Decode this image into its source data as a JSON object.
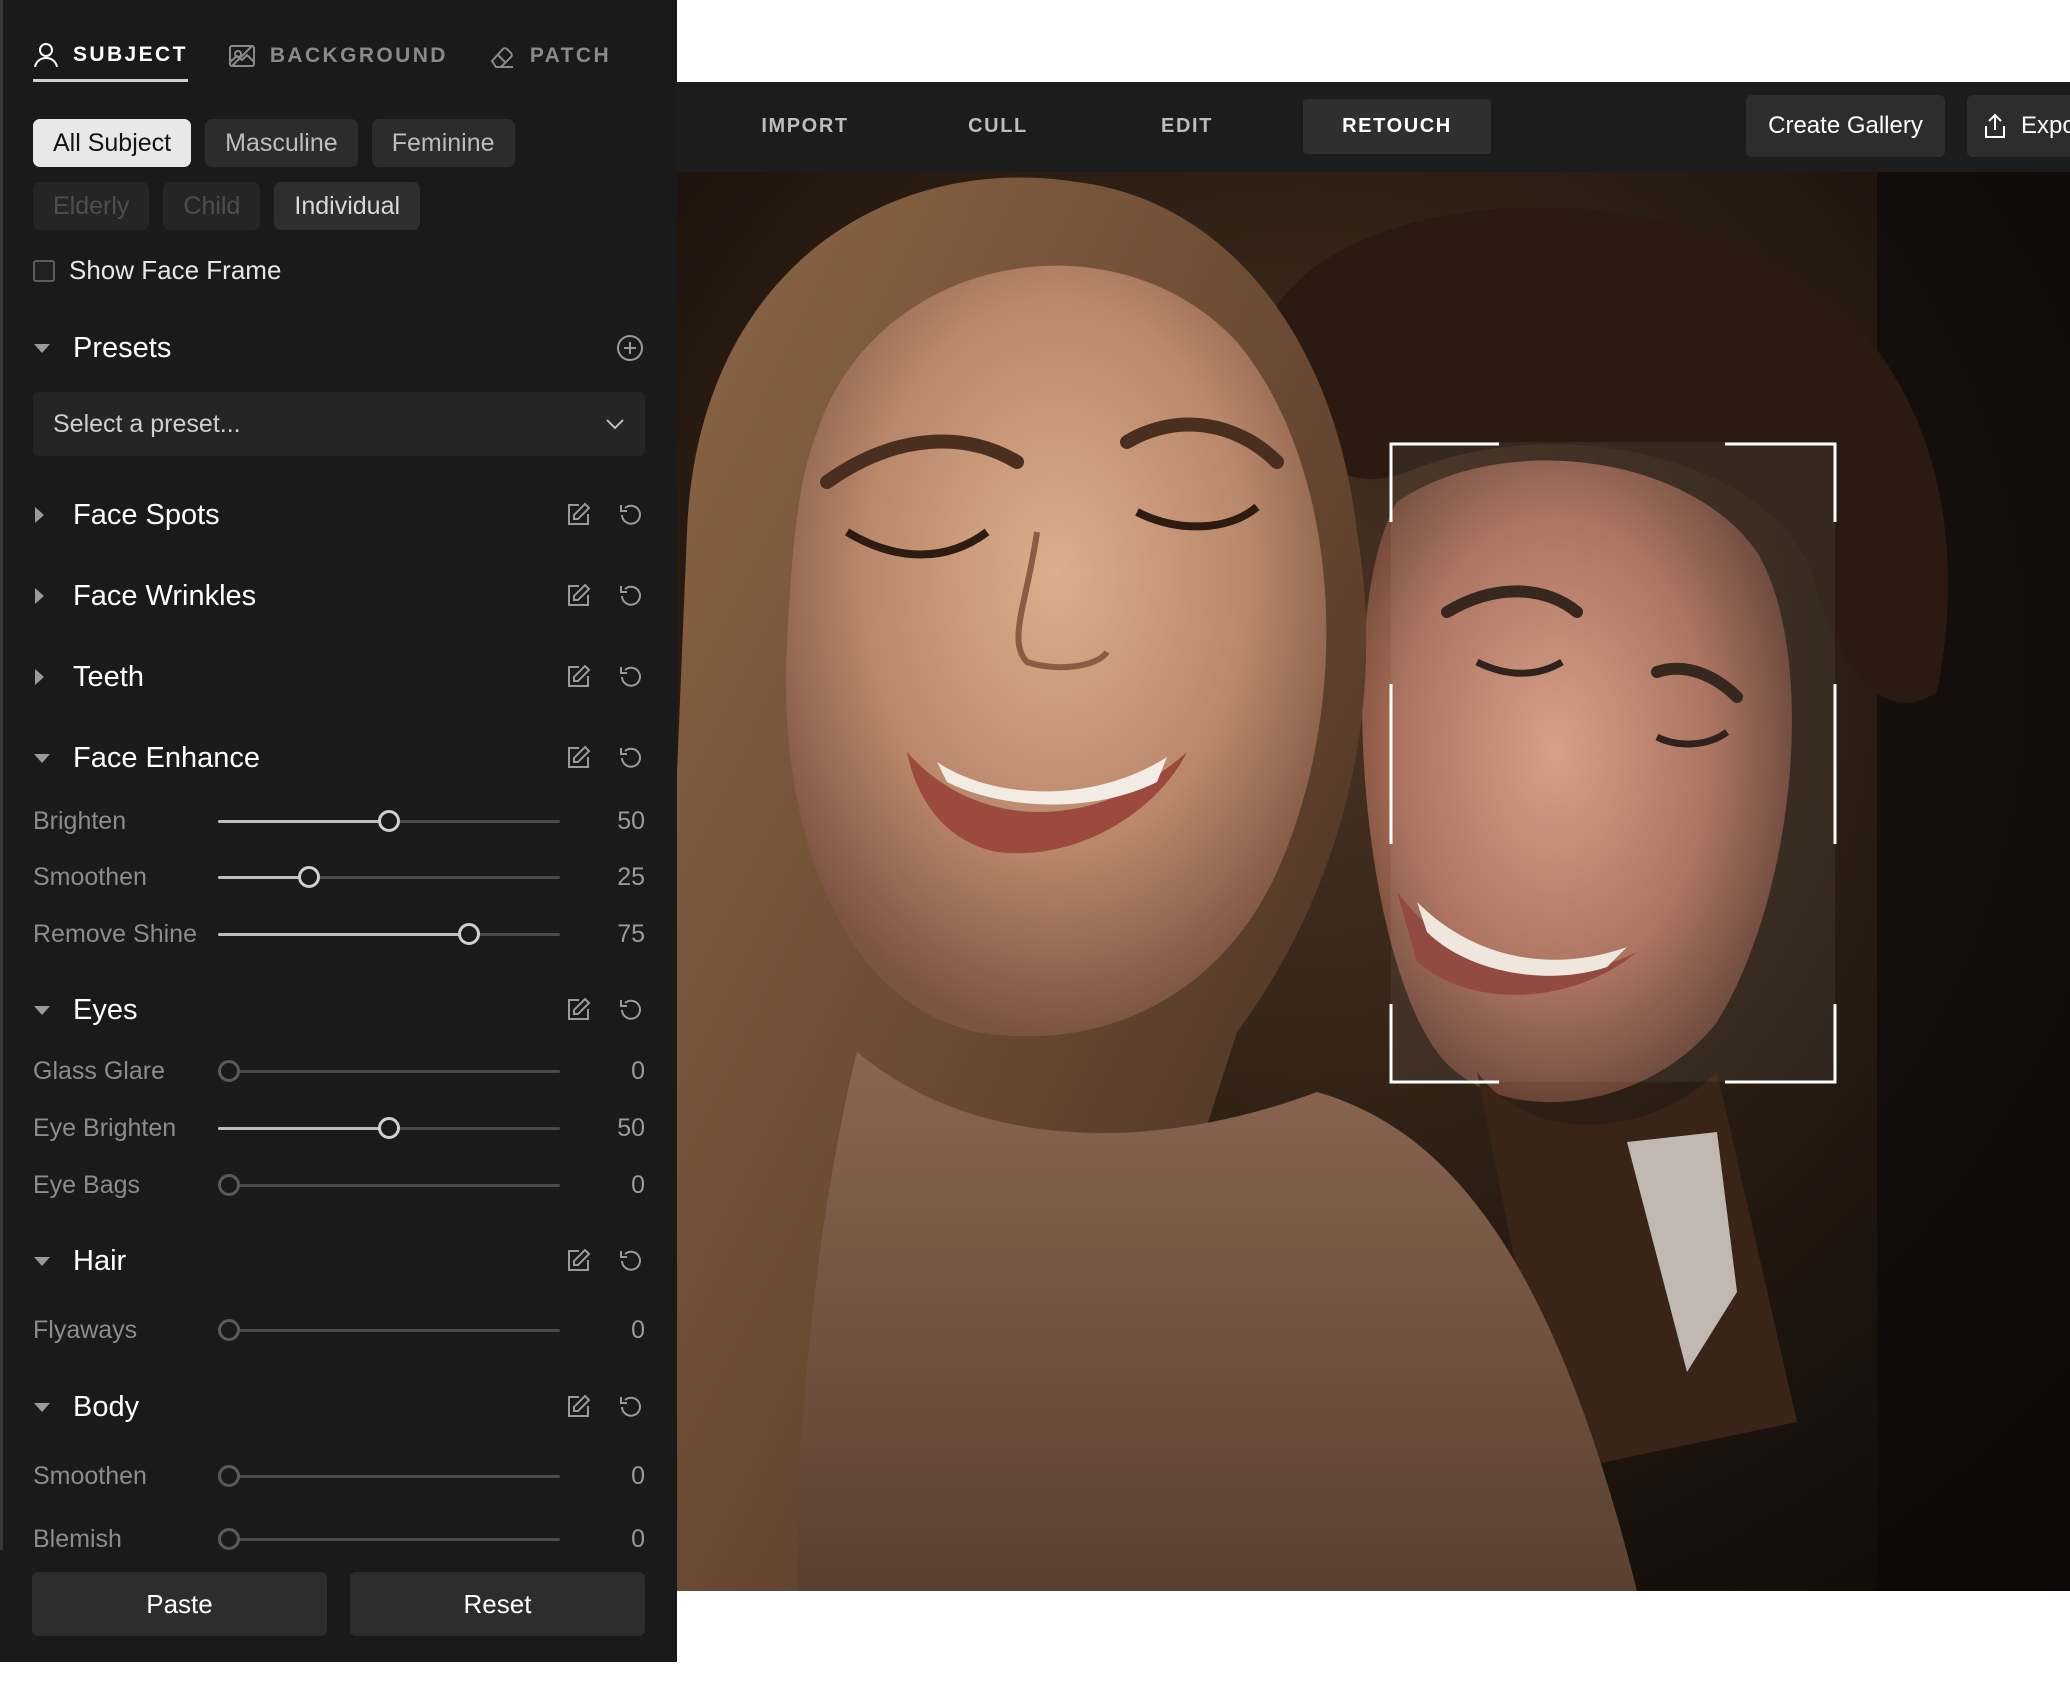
{
  "panel": {
    "tabs": [
      {
        "label": "SUBJECT",
        "icon": "person-icon",
        "active": true
      },
      {
        "label": "BACKGROUND",
        "icon": "background-icon",
        "active": false
      },
      {
        "label": "PATCH",
        "icon": "eraser-icon",
        "active": false
      }
    ],
    "subject_filters": {
      "all": "All Subject",
      "masculine": "Masculine",
      "feminine": "Feminine",
      "elderly": "Elderly",
      "child": "Child",
      "individual": "Individual"
    },
    "show_face_frame": {
      "label": "Show Face Frame",
      "checked": false
    },
    "presets": {
      "title": "Presets",
      "placeholder": "Select a preset...",
      "add_icon": "plus-circle-icon"
    },
    "sections": {
      "face_spots": "Face Spots",
      "face_wrinkles": "Face Wrinkles",
      "teeth": "Teeth",
      "face_enhance": "Face Enhance",
      "eyes": "Eyes",
      "hair": "Hair",
      "body": "Body"
    },
    "sliders": {
      "brighten": {
        "label": "Brighten",
        "value": "50"
      },
      "smoothen": {
        "label": "Smoothen",
        "value": "25"
      },
      "remove_shine": {
        "label": "Remove Shine",
        "value": "75"
      },
      "glass_glare": {
        "label": "Glass Glare",
        "value": "0"
      },
      "eye_brighten": {
        "label": "Eye Brighten",
        "value": "50"
      },
      "eye_bags": {
        "label": "Eye Bags",
        "value": "0"
      },
      "flyaways": {
        "label": "Flyaways",
        "value": "0"
      },
      "body_smoothen": {
        "label": "Smoothen",
        "value": "0"
      },
      "blemish": {
        "label": "Blemish",
        "value": "0"
      }
    },
    "footer": {
      "paste": "Paste",
      "reset": "Reset"
    }
  },
  "topbar": {
    "nav": {
      "import": "IMPORT",
      "cull": "CULL",
      "edit": "EDIT",
      "retouch": "RETOUCH"
    },
    "active_tab": "RETOUCH",
    "create_gallery": "Create Gallery",
    "export": "Expo"
  },
  "colors": {
    "panel_bg": "#1a1a1a",
    "topbar_bg": "#1c1c1c",
    "accent_chip": "#e8e8e8",
    "face_frame": "#ffffff"
  }
}
